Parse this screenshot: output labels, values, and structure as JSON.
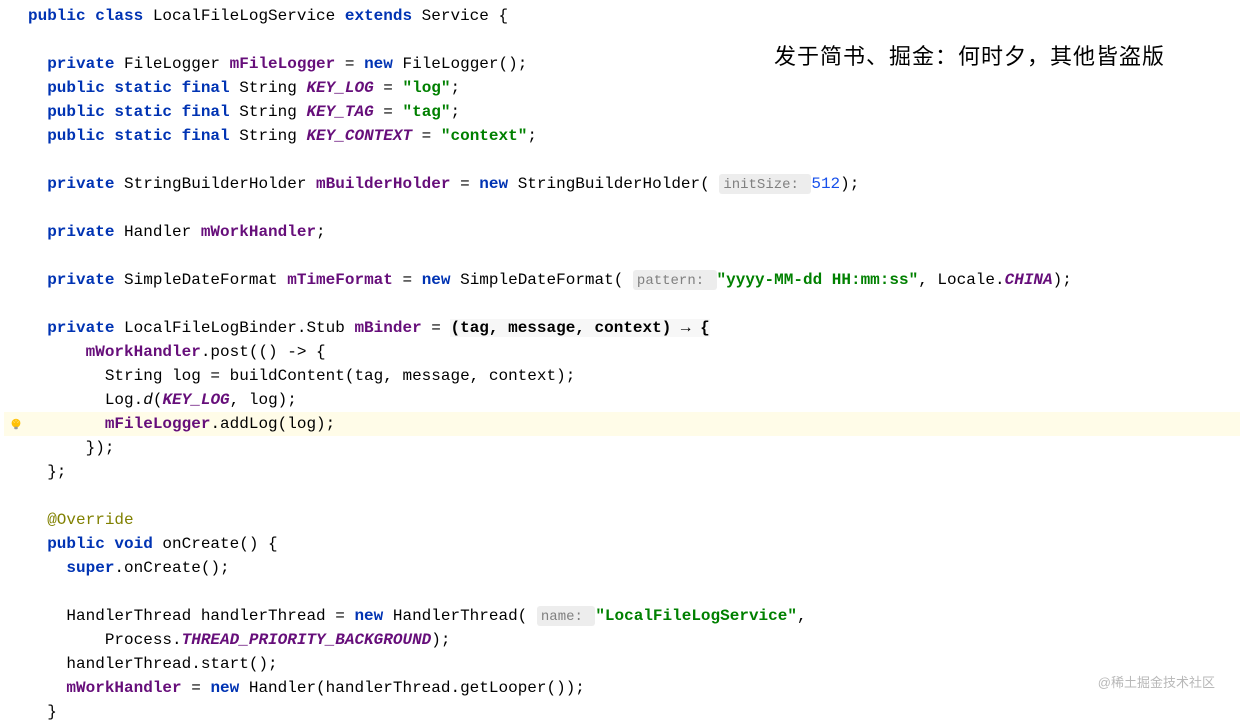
{
  "watermarks": {
    "top": "发于简书、掘金：何时夕，其他皆盗版",
    "bottom": "@稀土掘金技术社区"
  },
  "code": {
    "lines": [
      {
        "indent": 0,
        "tokens": [
          {
            "t": "public class ",
            "c": "keyword"
          },
          {
            "t": "LocalFileLogService ",
            "c": "type"
          },
          {
            "t": "extends ",
            "c": "keyword"
          },
          {
            "t": "Service {",
            "c": "type"
          }
        ]
      },
      {
        "indent": 0,
        "tokens": []
      },
      {
        "indent": 1,
        "tokens": [
          {
            "t": "private ",
            "c": "keyword"
          },
          {
            "t": "FileLogger ",
            "c": "type"
          },
          {
            "t": "mFileLogger",
            "c": "field"
          },
          {
            "t": " = ",
            "c": ""
          },
          {
            "t": "new ",
            "c": "keyword"
          },
          {
            "t": "FileLogger();",
            "c": "type"
          }
        ]
      },
      {
        "indent": 1,
        "tokens": [
          {
            "t": "public static final ",
            "c": "keyword"
          },
          {
            "t": "String ",
            "c": "type"
          },
          {
            "t": "KEY_LOG",
            "c": "constant-italic"
          },
          {
            "t": " = ",
            "c": ""
          },
          {
            "t": "\"log\"",
            "c": "string"
          },
          {
            "t": ";",
            "c": ""
          }
        ]
      },
      {
        "indent": 1,
        "tokens": [
          {
            "t": "public static final ",
            "c": "keyword"
          },
          {
            "t": "String ",
            "c": "type"
          },
          {
            "t": "KEY_TAG",
            "c": "constant-italic"
          },
          {
            "t": " = ",
            "c": ""
          },
          {
            "t": "\"tag\"",
            "c": "string"
          },
          {
            "t": ";",
            "c": ""
          }
        ]
      },
      {
        "indent": 1,
        "tokens": [
          {
            "t": "public static final ",
            "c": "keyword"
          },
          {
            "t": "String ",
            "c": "type"
          },
          {
            "t": "KEY_CONTEXT",
            "c": "constant-italic"
          },
          {
            "t": " = ",
            "c": ""
          },
          {
            "t": "\"context\"",
            "c": "string"
          },
          {
            "t": ";",
            "c": ""
          }
        ]
      },
      {
        "indent": 0,
        "tokens": []
      },
      {
        "indent": 1,
        "tokens": [
          {
            "t": "private ",
            "c": "keyword"
          },
          {
            "t": "StringBuilderHolder ",
            "c": "type"
          },
          {
            "t": "mBuilderHolder",
            "c": "field"
          },
          {
            "t": " = ",
            "c": ""
          },
          {
            "t": "new ",
            "c": "keyword"
          },
          {
            "t": "StringBuilderHolder( ",
            "c": "type"
          },
          {
            "t": "initSize: ",
            "c": "hint",
            "hint": true
          },
          {
            "t": "512",
            "c": "number"
          },
          {
            "t": ");",
            "c": ""
          }
        ]
      },
      {
        "indent": 0,
        "tokens": []
      },
      {
        "indent": 1,
        "tokens": [
          {
            "t": "private ",
            "c": "keyword"
          },
          {
            "t": "Handler ",
            "c": "type"
          },
          {
            "t": "mWorkHandler",
            "c": "field"
          },
          {
            "t": ";",
            "c": ""
          }
        ]
      },
      {
        "indent": 0,
        "tokens": []
      },
      {
        "indent": 1,
        "tokens": [
          {
            "t": "private ",
            "c": "keyword"
          },
          {
            "t": "SimpleDateFormat ",
            "c": "type"
          },
          {
            "t": "mTimeFormat",
            "c": "field"
          },
          {
            "t": " = ",
            "c": ""
          },
          {
            "t": "new ",
            "c": "keyword"
          },
          {
            "t": "SimpleDateFormat( ",
            "c": "type"
          },
          {
            "t": "pattern: ",
            "c": "hint",
            "hint": true
          },
          {
            "t": "\"yyyy-MM-dd HH:mm:ss\"",
            "c": "string"
          },
          {
            "t": ", Locale.",
            "c": ""
          },
          {
            "t": "CHINA",
            "c": "constant-italic"
          },
          {
            "t": ");",
            "c": ""
          }
        ]
      },
      {
        "indent": 0,
        "tokens": []
      },
      {
        "indent": 1,
        "tokens": [
          {
            "t": "private ",
            "c": "keyword"
          },
          {
            "t": "LocalFileLogBinder.Stub ",
            "c": "type"
          },
          {
            "t": "mBinder",
            "c": "field"
          },
          {
            "t": " = ",
            "c": ""
          },
          {
            "t": "(tag, message, context) → {",
            "c": "lambda"
          }
        ]
      },
      {
        "indent": 3,
        "tokens": [
          {
            "t": "mWorkHandler",
            "c": "field"
          },
          {
            "t": ".post(() -> {",
            "c": ""
          }
        ]
      },
      {
        "indent": 4,
        "tokens": [
          {
            "t": "String log = buildContent(tag, message, context);",
            "c": ""
          }
        ]
      },
      {
        "indent": 4,
        "tokens": [
          {
            "t": "Log.",
            "c": ""
          },
          {
            "t": "d",
            "c": "static-method"
          },
          {
            "t": "(",
            "c": ""
          },
          {
            "t": "KEY_LOG",
            "c": "constant-italic"
          },
          {
            "t": ", log);",
            "c": ""
          }
        ]
      },
      {
        "indent": 4,
        "highlighted": true,
        "bulb": true,
        "tokens": [
          {
            "t": "mFileLogger",
            "c": "field"
          },
          {
            "t": ".addLog(log);",
            "c": ""
          }
        ]
      },
      {
        "indent": 3,
        "tokens": [
          {
            "t": "});",
            "c": ""
          }
        ]
      },
      {
        "indent": 1,
        "tokens": [
          {
            "t": "};",
            "c": ""
          }
        ]
      },
      {
        "indent": 0,
        "tokens": []
      },
      {
        "indent": 1,
        "tokens": [
          {
            "t": "@Override",
            "c": "annotation"
          }
        ]
      },
      {
        "indent": 1,
        "tokens": [
          {
            "t": "public void ",
            "c": "keyword"
          },
          {
            "t": "onCreate() {",
            "c": "type"
          }
        ]
      },
      {
        "indent": 2,
        "tokens": [
          {
            "t": "super",
            "c": "keyword"
          },
          {
            "t": ".onCreate();",
            "c": ""
          }
        ]
      },
      {
        "indent": 0,
        "tokens": []
      },
      {
        "indent": 2,
        "tokens": [
          {
            "t": "HandlerThread handlerThread = ",
            "c": ""
          },
          {
            "t": "new ",
            "c": "keyword"
          },
          {
            "t": "HandlerThread( ",
            "c": "type"
          },
          {
            "t": "name: ",
            "c": "hint",
            "hint": true
          },
          {
            "t": "\"LocalFileLogService\"",
            "c": "string"
          },
          {
            "t": ",",
            "c": ""
          }
        ]
      },
      {
        "indent": 4,
        "tokens": [
          {
            "t": "Process.",
            "c": ""
          },
          {
            "t": "THREAD_PRIORITY_BACKGROUND",
            "c": "constant-italic"
          },
          {
            "t": ");",
            "c": ""
          }
        ]
      },
      {
        "indent": 2,
        "tokens": [
          {
            "t": "handlerThread.start();",
            "c": ""
          }
        ]
      },
      {
        "indent": 2,
        "tokens": [
          {
            "t": "mWorkHandler",
            "c": "field"
          },
          {
            "t": " = ",
            "c": ""
          },
          {
            "t": "new ",
            "c": "keyword"
          },
          {
            "t": "Handler(handlerThread.getLooper());",
            "c": "type"
          }
        ]
      },
      {
        "indent": 1,
        "tokens": [
          {
            "t": "}",
            "c": ""
          }
        ]
      }
    ]
  }
}
